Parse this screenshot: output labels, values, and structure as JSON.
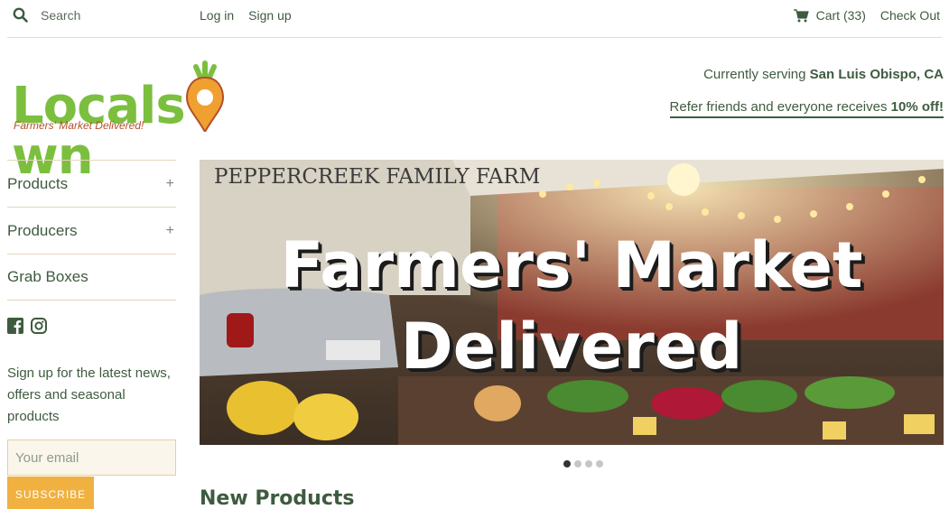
{
  "header": {
    "search_label": "Search",
    "search_icon": "search-icon",
    "login_label": "Log in",
    "signup_label": "Sign up",
    "cart_label": "Cart (33)",
    "cart_icon": "cart-icon",
    "checkout_label": "Check Out"
  },
  "brand": {
    "logo_text_left": "Locals",
    "logo_text_right": "wn",
    "tagline": "Farmers' Market Delivered!",
    "logo_green": "#7cbf3f",
    "logo_orange": "#f0a030"
  },
  "location": {
    "serving_prefix": "Currently serving ",
    "serving_city": "San Luis Obispo, CA",
    "refer_prefix": "Refer friends and everyone receives ",
    "refer_bold": "10% off!"
  },
  "sidebar": {
    "items": [
      {
        "label": "Products",
        "expand": "+"
      },
      {
        "label": "Producers",
        "expand": "+"
      },
      {
        "label": "Grab Boxes"
      }
    ],
    "social_icons": [
      "facebook-icon",
      "instagram-icon"
    ],
    "newsletter_text": "Sign up for the latest news, offers and seasonal products",
    "email_placeholder": "Your email",
    "subscribe_label": "SUBSCRIBE"
  },
  "hero": {
    "line1": "Farmers' Market",
    "line2": "Delivered",
    "sign_text": "PEPPERCREEK FAMILY FARM",
    "slides": 4,
    "active_slide": 1
  },
  "main": {
    "section_title": "New Products"
  },
  "colors": {
    "text_green": "#3e5b3f",
    "accent_yellow": "#f0b141",
    "divider": "#e3d7bd"
  }
}
